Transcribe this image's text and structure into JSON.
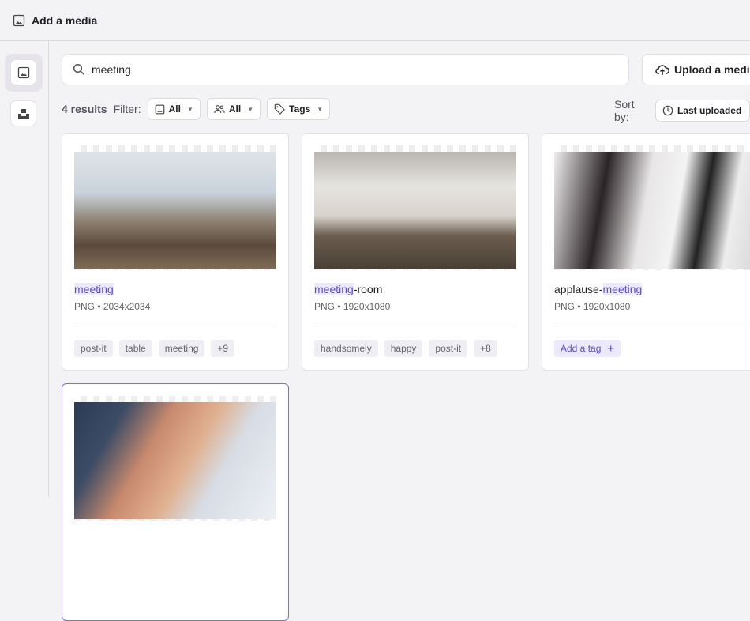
{
  "header": {
    "title": "Add a media"
  },
  "search": {
    "value": "meeting"
  },
  "upload": {
    "label": "Upload a media"
  },
  "filters": {
    "results": "4 results",
    "filter_label": "Filter:",
    "type": "All",
    "owner": "All",
    "tags": "Tags"
  },
  "sort": {
    "label": "Sort by:",
    "value": "Last uploaded"
  },
  "cards": [
    {
      "hl": "meeting",
      "rest": "",
      "meta": "PNG • 2034x2034",
      "tags": [
        "post-it",
        "table",
        "meeting",
        "+9"
      ]
    },
    {
      "hl": "meeting",
      "rest": "-room",
      "pre": "",
      "meta": "PNG • 1920x1080",
      "tags": [
        "handsomely",
        "happy",
        "post-it",
        "+8"
      ]
    },
    {
      "pre": "applause-",
      "hl": "meeting",
      "meta": "PNG • 1920x1080",
      "add_tag": "Add a tag",
      "plus": "+"
    },
    {}
  ]
}
